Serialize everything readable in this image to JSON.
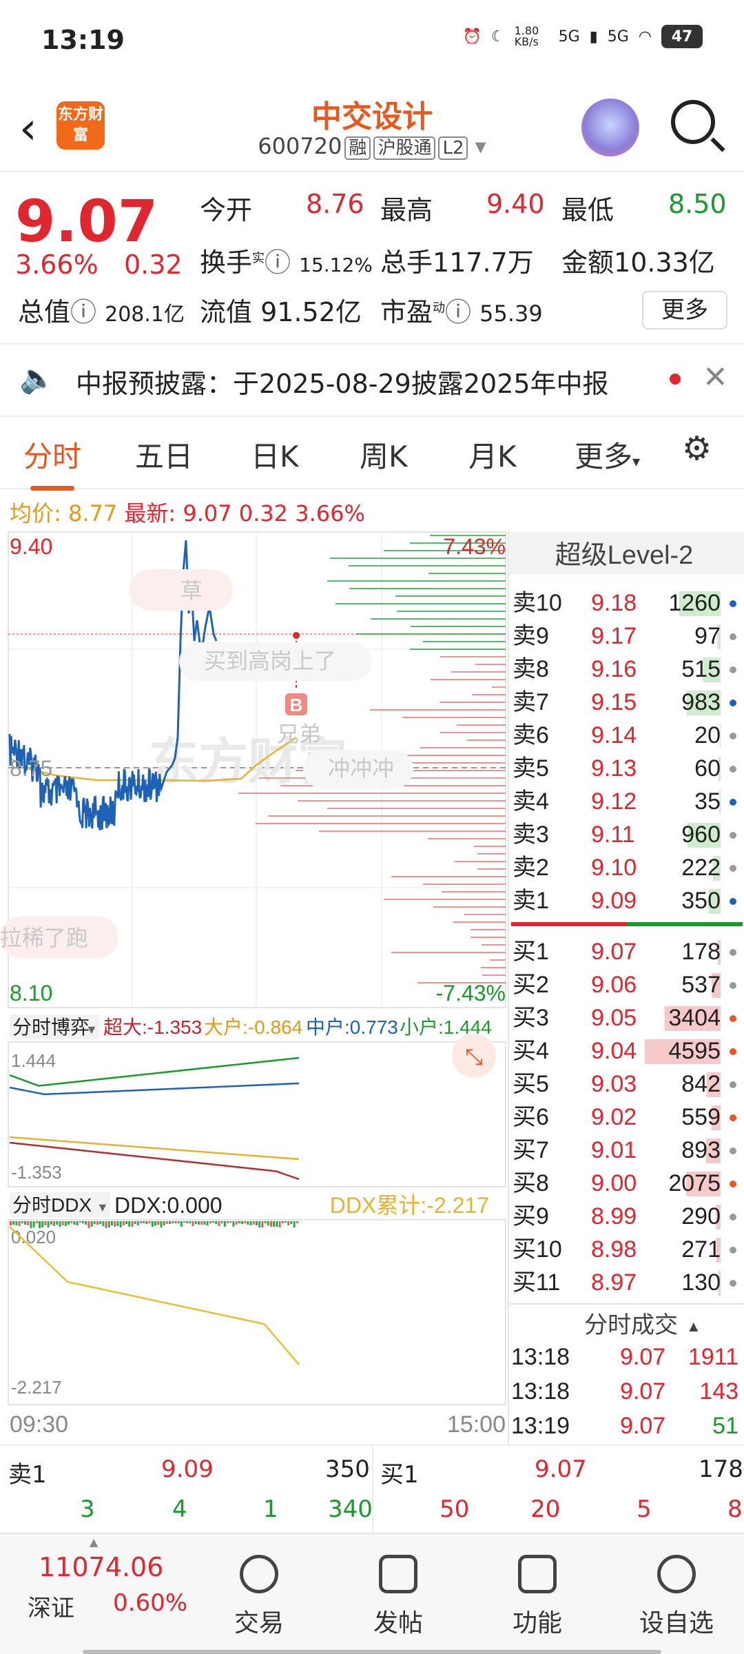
{
  "status": {
    "time": "13:19",
    "net_speed": "1.80 KB/s",
    "sig1": "5G",
    "sig2": "5G",
    "battery": "47"
  },
  "header": {
    "logo_text": "东方财富",
    "title": "中交设计",
    "code": "600720",
    "tags": [
      "融",
      "沪股通",
      "L2"
    ]
  },
  "quote": {
    "price": "9.07",
    "change_pct": "3.66%",
    "change": "0.32",
    "open_label": "今开",
    "open": "8.76",
    "high_label": "最高",
    "high": "9.40",
    "low_label": "最低",
    "low": "8.50",
    "turnover_label": "换手",
    "turnover_sup": "实",
    "turnover": "15.12%",
    "vol_label": "总手",
    "vol": "117.7万",
    "amount_label": "金额",
    "amount": "10.33亿",
    "mcap_label": "总值",
    "mcap": "208.1亿",
    "float_label": "流值",
    "float": "91.52亿",
    "pe_label": "市盈",
    "pe_sup": "动",
    "pe": "55.39",
    "more": "更多"
  },
  "notice": {
    "text": "中报预披露：于2025-08-29披露2025年中报"
  },
  "tabs": [
    "分时",
    "五日",
    "日K",
    "周K",
    "月K",
    "更多",
    "⚙"
  ],
  "avg": {
    "avg_label": "均价:",
    "avg": "8.77",
    "last_label": "最新:",
    "last": "9.07",
    "chg": "0.32",
    "pct": "3.66%"
  },
  "chart_labels": {
    "top_price": "9.40",
    "top_pct": "7.43%",
    "mid_price": "8.75",
    "bot_price": "8.10",
    "bot_pct": "-7.43%",
    "t_start": "09:30",
    "t_end": "15:00",
    "comments": [
      "草",
      "买到高岗上了",
      "兄弟",
      "冲冲冲",
      "拉稀了跑"
    ],
    "watermark": "东方财富",
    "b_mark": "B"
  },
  "flow": {
    "label": "分时博弈",
    "super": "超大:-1.353",
    "big": "大户:-0.864",
    "mid": "中户:0.773",
    "small": "小户:1.444",
    "top": "1.444",
    "bot": "-1.353"
  },
  "ddx": {
    "label": "分时DDX",
    "ddx": "DDX:0.000",
    "cum": "DDX累计:-2.217",
    "top": "0.020",
    "bot": "-2.217"
  },
  "book": {
    "title": "超级Level-2",
    "asks": [
      [
        "卖10",
        "9.18",
        "1260"
      ],
      [
        "卖9",
        "9.17",
        "97"
      ],
      [
        "卖8",
        "9.16",
        "515"
      ],
      [
        "卖7",
        "9.15",
        "983"
      ],
      [
        "卖6",
        "9.14",
        "20"
      ],
      [
        "卖5",
        "9.13",
        "60"
      ],
      [
        "卖4",
        "9.12",
        "35"
      ],
      [
        "卖3",
        "9.11",
        "960"
      ],
      [
        "卖2",
        "9.10",
        "222"
      ],
      [
        "卖1",
        "9.09",
        "350"
      ]
    ],
    "bids": [
      [
        "买1",
        "9.07",
        "178"
      ],
      [
        "买2",
        "9.06",
        "537"
      ],
      [
        "买3",
        "9.05",
        "3404"
      ],
      [
        "买4",
        "9.04",
        "4595"
      ],
      [
        "买5",
        "9.03",
        "842"
      ],
      [
        "买6",
        "9.02",
        "559"
      ],
      [
        "买7",
        "9.01",
        "893"
      ],
      [
        "买8",
        "9.00",
        "2075"
      ],
      [
        "买9",
        "8.99",
        "290"
      ],
      [
        "买10",
        "8.98",
        "271"
      ],
      [
        "买11",
        "8.97",
        "130"
      ]
    ],
    "ticks_title": "分时成交",
    "ticks": [
      [
        "13:18",
        "9.07",
        "1911"
      ],
      [
        "13:18",
        "9.07",
        "143"
      ],
      [
        "13:19",
        "9.07",
        "51"
      ]
    ]
  },
  "tradebar": {
    "ask_label": "卖1",
    "ask_price": "9.09",
    "ask_vol": "350",
    "bid_label": "买1",
    "bid_price": "9.07",
    "bid_vol": "178",
    "ask_detail": [
      "3",
      "4",
      "1",
      "340"
    ],
    "bid_detail": [
      "50",
      "20",
      "5",
      "8"
    ]
  },
  "nav": {
    "index_value": "11074.06",
    "index_name": "深证",
    "index_pct": "0.60%",
    "items": [
      "交易",
      "发帖",
      "功能",
      "设自选"
    ]
  }
}
